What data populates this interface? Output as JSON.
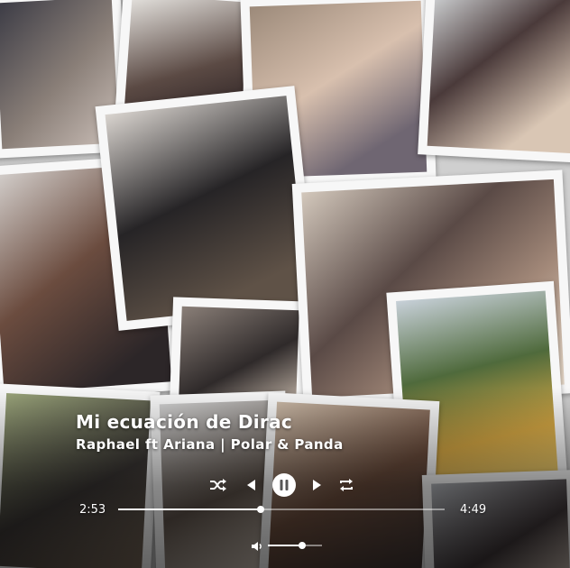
{
  "player": {
    "title": "Mi ecuación de Dirac",
    "artist_line": "Raphael ft Ariana | Polar & Panda",
    "elapsed": "2:53",
    "duration": "4:49",
    "progress": 0.437,
    "volume": 0.63,
    "state": "playing"
  },
  "icons": {
    "shuffle": "shuffle-icon",
    "previous": "previous-icon",
    "pause": "pause-icon",
    "next": "next-icon",
    "repeat": "repeat-icon",
    "volume": "volume-icon"
  },
  "colors": {
    "text": "#ffffff",
    "background": "#cfcfcf",
    "photo_frame": "#f7f7f7"
  }
}
